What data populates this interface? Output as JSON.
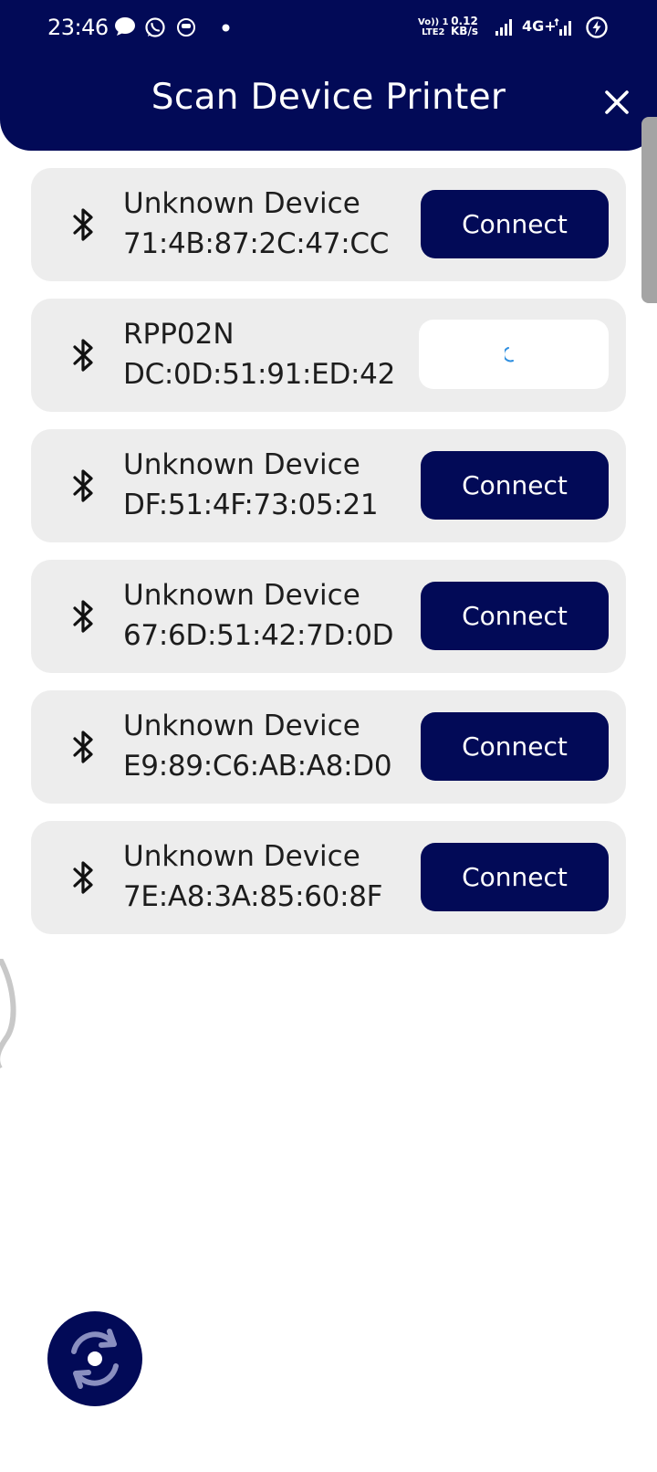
{
  "status_bar": {
    "time": "23:46",
    "volte_top": "Vo)) 1",
    "volte_bottom": "LTE2",
    "speed_value": "0.12",
    "speed_unit": "KB/s",
    "network": "4G+",
    "icons": [
      "message-icon",
      "whatsapp-icon",
      "app-icon",
      "dot-icon",
      "signal-icon",
      "signal-icon",
      "battery-charging-icon"
    ]
  },
  "header": {
    "title": "Scan Device Printer",
    "close_icon": "close-icon"
  },
  "colors": {
    "primary": "#020a57",
    "card_background": "#ededed",
    "spinner": "#2f8fe0"
  },
  "devices": [
    {
      "name": "Unknown Device",
      "address": "71:4B:87:2C:47:CC",
      "button_label": "Connect",
      "state": "idle"
    },
    {
      "name": "RPP02N",
      "address": "DC:0D:51:91:ED:42",
      "button_label": "",
      "state": "connecting"
    },
    {
      "name": "Unknown Device",
      "address": "DF:51:4F:73:05:21",
      "button_label": "Connect",
      "state": "idle"
    },
    {
      "name": "Unknown Device",
      "address": "67:6D:51:42:7D:0D",
      "button_label": "Connect",
      "state": "idle"
    },
    {
      "name": "Unknown Device",
      "address": "E9:89:C6:AB:A8:D0",
      "button_label": "Connect",
      "state": "idle"
    },
    {
      "name": "Unknown Device",
      "address": "7E:A8:3A:85:60:8F",
      "button_label": "Connect",
      "state": "idle"
    }
  ],
  "fab": {
    "icon": "refresh-icon"
  }
}
